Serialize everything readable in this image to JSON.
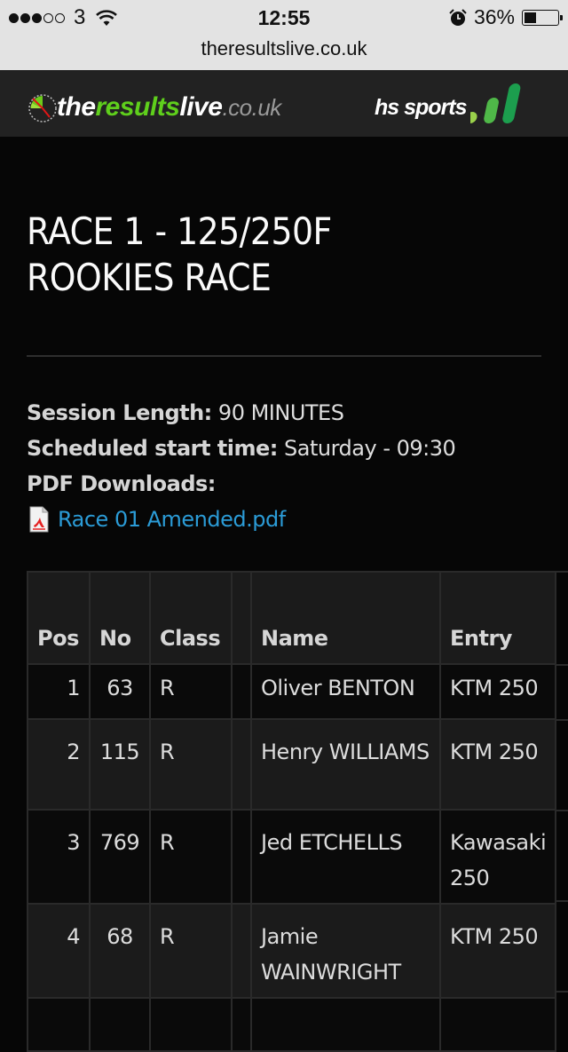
{
  "status_bar": {
    "signal_filled": 3,
    "signal_total": 5,
    "carrier": "3",
    "time": "12:55",
    "battery_percent_label": "36%",
    "battery_level": 0.36,
    "icons": [
      "signal-dots-icon",
      "wifi-icon",
      "alarm-icon",
      "battery-icon"
    ]
  },
  "browser": {
    "url": "theresultslive.co.uk"
  },
  "header": {
    "logo_left": {
      "the": "the",
      "results": "results",
      "live": "live",
      "domain": ".co.uk"
    },
    "logo_right": {
      "text": "hs sports"
    },
    "colors": {
      "results_green": "#5fcf1c",
      "header_bg": "#222222"
    }
  },
  "race": {
    "title_line1": "RACE 1 - 125/250F",
    "title_line2": "ROOKIES RACE",
    "session_length_label": "Session Length:",
    "session_length_value": "90 MINUTES",
    "start_time_label": "Scheduled start time:",
    "start_time_value": "Saturday - 09:30",
    "pdf_label": "PDF Downloads:",
    "pdf_link": "Race 01 Amended.pdf",
    "link_color": "#2b9bd6"
  },
  "table": {
    "headers": {
      "pos": "Pos",
      "no": "No",
      "class": "Class",
      "blank": "",
      "name": "Name",
      "entry": "Entry"
    },
    "rows": [
      {
        "pos": "1",
        "no": "63",
        "class": "R",
        "name": "Oliver BENTON",
        "entry": "KTM 250"
      },
      {
        "pos": "2",
        "no": "115",
        "class": "R",
        "name": "Henry WILLIAMS",
        "entry": "KTM 250"
      },
      {
        "pos": "3",
        "no": "769",
        "class": "R",
        "name": "Jed ETCHELLS",
        "entry": "Kawasaki 250"
      },
      {
        "pos": "4",
        "no": "68",
        "class": "R",
        "name": "Jamie WAINWRIGHT",
        "entry": "KTM 250"
      },
      {
        "pos": "",
        "no": "",
        "class": "",
        "name": "",
        "entry": ""
      }
    ]
  }
}
